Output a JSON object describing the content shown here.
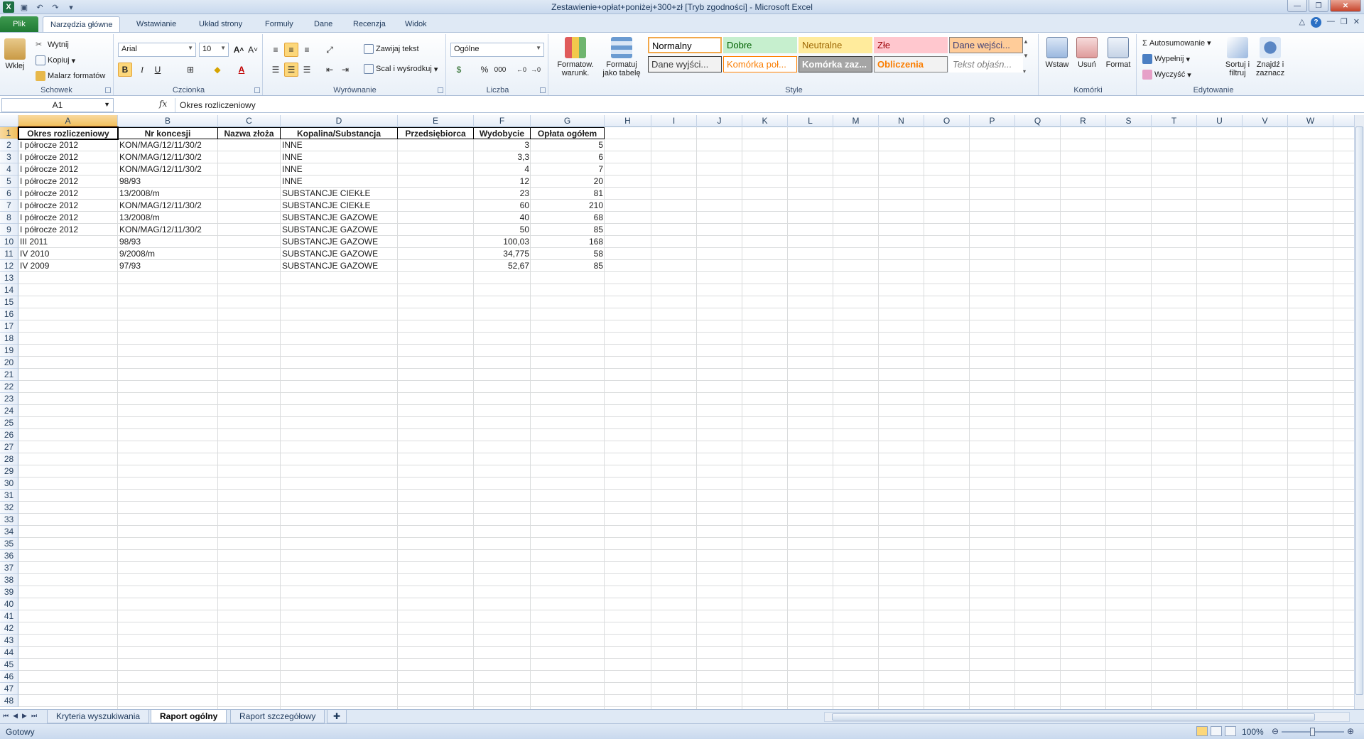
{
  "window": {
    "title": "Zestawienie+opłat+poniżej+300+zł  [Tryb zgodności]  -  Microsoft Excel"
  },
  "ribbon_tabs": [
    "Plik",
    "Narzędzia główne",
    "Wstawianie",
    "Układ strony",
    "Formuły",
    "Dane",
    "Recenzja",
    "Widok"
  ],
  "ribbon": {
    "clipboard": {
      "paste": "Wklej",
      "cut": "Wytnij",
      "copy": "Kopiuj",
      "painter": "Malarz formatów",
      "label": "Schowek"
    },
    "font": {
      "name": "Arial",
      "size": "10",
      "label": "Czcionka",
      "bold": "B",
      "italic": "I",
      "underline": "U"
    },
    "alignment": {
      "wrap": "Zawijaj tekst",
      "merge": "Scal i wyśrodkuj",
      "label": "Wyrównanie"
    },
    "number": {
      "format": "Ogólne",
      "percent": "%",
      "thousands": "000",
      "label": "Liczba"
    },
    "styles": {
      "cond_format": "Formatow. warunk.",
      "as_table": "Formatuj jako tabelę",
      "cells": [
        {
          "text": "Normalny",
          "bg": "#ffffff",
          "fg": "#000000",
          "border": "#f2a84a"
        },
        {
          "text": "Dobre",
          "bg": "#c6efce",
          "fg": "#006100",
          "border": "#c6efce"
        },
        {
          "text": "Neutralne",
          "bg": "#ffeb9c",
          "fg": "#9c6500",
          "border": "#ffeb9c"
        },
        {
          "text": "Złe",
          "bg": "#ffc7ce",
          "fg": "#9c0006",
          "border": "#ffc7ce"
        },
        {
          "text": "Dane wejści...",
          "bg": "#ffcc99",
          "fg": "#3f3f76",
          "border": "#7f7f7f"
        },
        {
          "text": "Dane wyjści...",
          "bg": "#f2f2f2",
          "fg": "#3f3f3f",
          "border": "#3f3f3f"
        },
        {
          "text": "Komórka poł...",
          "bg": "#ffffff",
          "fg": "#fa7d00",
          "border": "#ff8001"
        },
        {
          "text": "Komórka zaz...",
          "bg": "#a5a5a5",
          "fg": "#ffffff",
          "border": "#3f3f3f"
        },
        {
          "text": "Obliczenia",
          "bg": "#f2f2f2",
          "fg": "#fa7d00",
          "border": "#7f7f7f"
        },
        {
          "text": "Tekst objaśn...",
          "bg": "#ffffff",
          "fg": "#7f7f7f",
          "border": "#ffffff"
        }
      ],
      "label": "Style"
    },
    "cells": {
      "insert": "Wstaw",
      "delete": "Usuń",
      "format": "Format",
      "label": "Komórki"
    },
    "editing": {
      "autosum": "Autosumowanie",
      "fill": "Wypełnij",
      "clear": "Wyczyść",
      "sort": "Sortuj i filtruj",
      "find": "Znajdź i zaznacz",
      "label": "Edytowanie"
    }
  },
  "formula_bar": {
    "name_box": "A1",
    "fx": "fx",
    "content": "Okres rozliczeniowy"
  },
  "columns": [
    "A",
    "B",
    "C",
    "D",
    "E",
    "F",
    "G",
    "H",
    "I",
    "J",
    "K",
    "L",
    "M",
    "N",
    "O",
    "P",
    "Q",
    "R",
    "S",
    "T",
    "U",
    "V",
    "W"
  ],
  "row_numbers": [
    "1",
    "2",
    "3",
    "4",
    "5",
    "6",
    "7",
    "8",
    "9",
    "10",
    "11",
    "12",
    "13",
    "14",
    "15",
    "16",
    "17",
    "18",
    "19",
    "20",
    "21",
    "22",
    "23",
    "24",
    "25",
    "26",
    "27",
    "28",
    "29",
    "30",
    "31",
    "32",
    "33",
    "34",
    "35",
    "36",
    "37",
    "38",
    "39",
    "40",
    "41",
    "42",
    "43",
    "44",
    "45",
    "46",
    "47",
    "48"
  ],
  "sheet": {
    "headers": [
      "Okres rozliczeniowy",
      "Nr koncesji",
      "Nazwa złoża",
      "Kopalina/Substancja",
      "Przedsiębiorca",
      "Wydobycie",
      "Opłata ogółem"
    ],
    "rows": [
      [
        "I półrocze 2012",
        "KON/MAG/12/11/30/2",
        "",
        "INNE",
        "",
        "3",
        "5"
      ],
      [
        "I półrocze 2012",
        "KON/MAG/12/11/30/2",
        "",
        "INNE",
        "",
        "3,3",
        "6"
      ],
      [
        "I półrocze 2012",
        "KON/MAG/12/11/30/2",
        "",
        "INNE",
        "",
        "4",
        "7"
      ],
      [
        "I półrocze 2012",
        "98/93",
        "",
        "INNE",
        "",
        "12",
        "20"
      ],
      [
        "I półrocze 2012",
        "13/2008/m",
        "",
        "SUBSTANCJE CIEKŁE",
        "",
        "23",
        "81"
      ],
      [
        "I półrocze 2012",
        "KON/MAG/12/11/30/2",
        "",
        "SUBSTANCJE CIEKŁE",
        "",
        "60",
        "210"
      ],
      [
        "I półrocze 2012",
        "13/2008/m",
        "",
        "SUBSTANCJE GAZOWE",
        "",
        "40",
        "68"
      ],
      [
        "I półrocze 2012",
        "KON/MAG/12/11/30/2",
        "",
        "SUBSTANCJE GAZOWE",
        "",
        "50",
        "85"
      ],
      [
        "III 2011",
        "98/93",
        "",
        "SUBSTANCJE GAZOWE",
        "",
        "100,03",
        "168"
      ],
      [
        "IV 2010",
        "9/2008/m",
        "",
        "SUBSTANCJE GAZOWE",
        "",
        "34,775",
        "58"
      ],
      [
        "IV 2009",
        "97/93",
        "",
        "SUBSTANCJE GAZOWE",
        "",
        "52,67",
        "85"
      ]
    ]
  },
  "sheet_tabs": [
    "Kryteria wyszukiwania",
    "Raport ogólny",
    "Raport szczegółowy"
  ],
  "active_sheet": "Raport ogólny",
  "status": {
    "text": "Gotowy",
    "zoom": "100%"
  }
}
